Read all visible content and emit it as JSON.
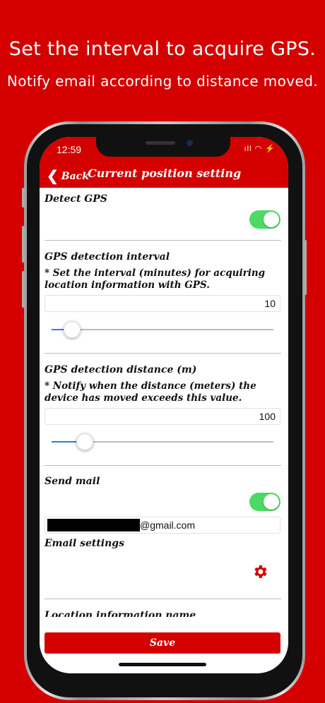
{
  "promo": {
    "headline": "Set the interval to acquire GPS.",
    "subheadline": "Notify email according to distance moved."
  },
  "status": {
    "time": "12:59",
    "signal": "ıll",
    "battery": "⚡"
  },
  "navbar": {
    "back_label": "Back",
    "title": "Current position setting"
  },
  "sections": {
    "detect_gps": {
      "label": "Detect GPS",
      "enabled": true
    },
    "interval": {
      "label": "GPS detection interval",
      "note": "* Set the interval (minutes) for acquiring location information with GPS.",
      "value": "10",
      "slider_fraction": 0.06
    },
    "distance": {
      "label": "GPS detection distance (m)",
      "note": "* Notify when the distance (meters) the device has moved exceeds this value.",
      "value": "100",
      "slider_fraction": 0.12
    },
    "send_mail": {
      "label": "Send mail",
      "enabled": true,
      "email_suffix": "@gmail.com"
    },
    "email_settings": {
      "label": "Email settings"
    },
    "location_name": {
      "label": "Location information name"
    }
  },
  "footer": {
    "save_label": "Save"
  },
  "colors": {
    "brand_red": "#d40000",
    "toggle_on": "#4cd964",
    "slider_blue": "#2a7de1"
  }
}
